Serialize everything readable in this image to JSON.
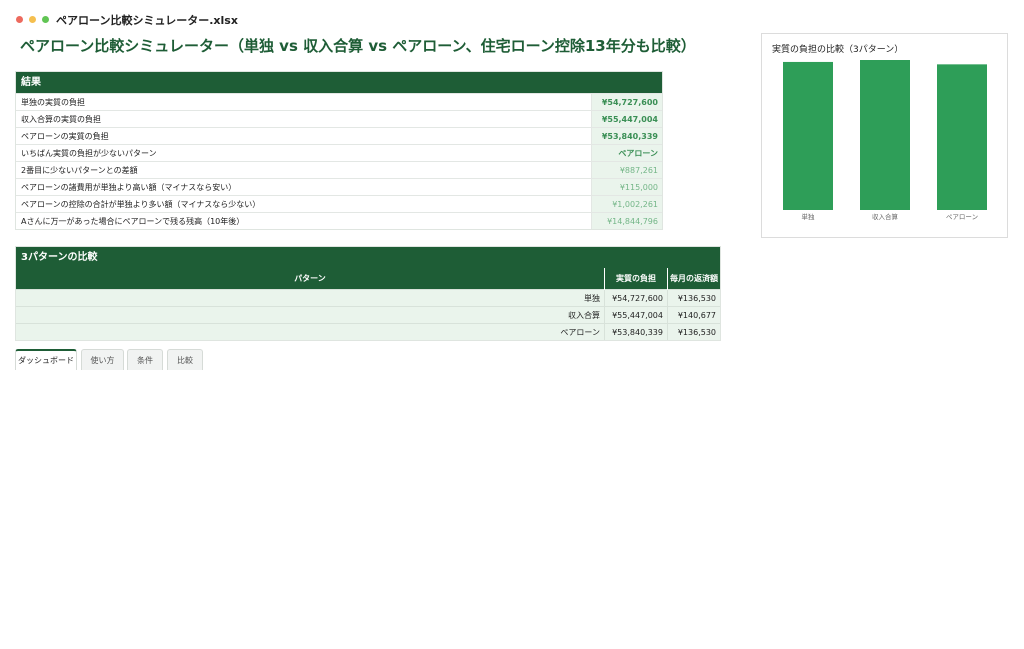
{
  "window": {
    "filename": "ペアローン比較シミュレーター.xlsx"
  },
  "page": {
    "title": "ペアローン比較シミュレーター（単独 vs 収入合算 vs ペアローン、住宅ローン控除13年分も比較）"
  },
  "results": {
    "header": "結果",
    "rows": [
      {
        "label": "単独の実質の負担",
        "value": "¥54,727,600"
      },
      {
        "label": "収入合算の実質の負担",
        "value": "¥55,447,004"
      },
      {
        "label": "ペアローンの実質の負担",
        "value": "¥53,840,339"
      },
      {
        "label": "いちばん実質の負担が少ないパターン",
        "value": "ペアローン"
      },
      {
        "label": "2番目に少ないパターンとの差額",
        "value": "¥887,261"
      },
      {
        "label": "ペアローンの諸費用が単独より高い額（マイナスなら安い）",
        "value": "¥115,000"
      },
      {
        "label": "ペアローンの控除の合計が単独より多い額（マイナスなら少ない）",
        "value": "¥1,002,261"
      },
      {
        "label": "Aさんに万一があった場合にペアローンで残る残高（10年後）",
        "value": "¥14,844,796"
      }
    ]
  },
  "compare": {
    "header": "3パターンの比較",
    "columns": [
      "パターン",
      "実質の負担",
      "毎月の返済額"
    ],
    "rows": [
      [
        "単独",
        "¥54,727,600",
        "¥136,530"
      ],
      [
        "収入合算",
        "¥55,447,004",
        "¥140,677"
      ],
      [
        "ペアローン",
        "¥53,840,339",
        "¥136,530"
      ]
    ]
  },
  "tabs": [
    "ダッシュボード",
    "使い方",
    "条件",
    "比較"
  ],
  "active_tab": "ダッシュボード",
  "colors": {
    "header_green": "#1e5d36",
    "bar_green": "#2e9e58",
    "value_bg": "#eaf4ec"
  },
  "chart": {
    "title": "実質の負担の比較（3パターン）",
    "chart_data": {
      "type": "bar",
      "categories": [
        "単独",
        "収入合算",
        "ペアローン"
      ],
      "values": [
        54727600,
        55447004,
        53840339
      ],
      "title": "実質の負担の比較（3パターン）",
      "xlabel": "",
      "ylabel": "",
      "ylim": [
        0,
        55447004
      ],
      "grid": false
    }
  }
}
